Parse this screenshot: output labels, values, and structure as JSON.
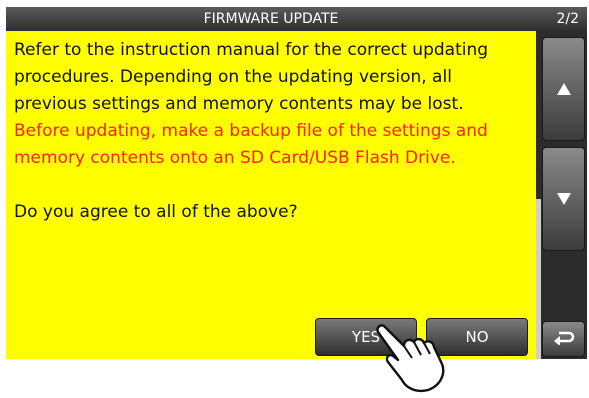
{
  "header": {
    "title": "FIRMWARE UPDATE",
    "page_indicator": "2/2"
  },
  "message": {
    "line1": "Refer to the instruction manual for the correct updating",
    "line2": "procedures. Depending on the updating version, all",
    "line3": "previous settings and memory contents may be lost.",
    "warning_line1": "Before updating, make a backup file of the settings and",
    "warning_line2": "memory contents onto an SD Card/USB Flash Drive.",
    "question": "Do you agree to all of the above?"
  },
  "buttons": {
    "yes_label": "YES",
    "no_label": "NO"
  },
  "icons": {
    "scroll_up": "triangle-up-icon",
    "scroll_down": "triangle-down-icon",
    "back": "return-arrow-icon",
    "pointer": "pointing-hand-icon"
  },
  "colors": {
    "content_background": "#ffff00",
    "warning_text": "#ff2020",
    "titlebar": "#3a3a3a"
  }
}
